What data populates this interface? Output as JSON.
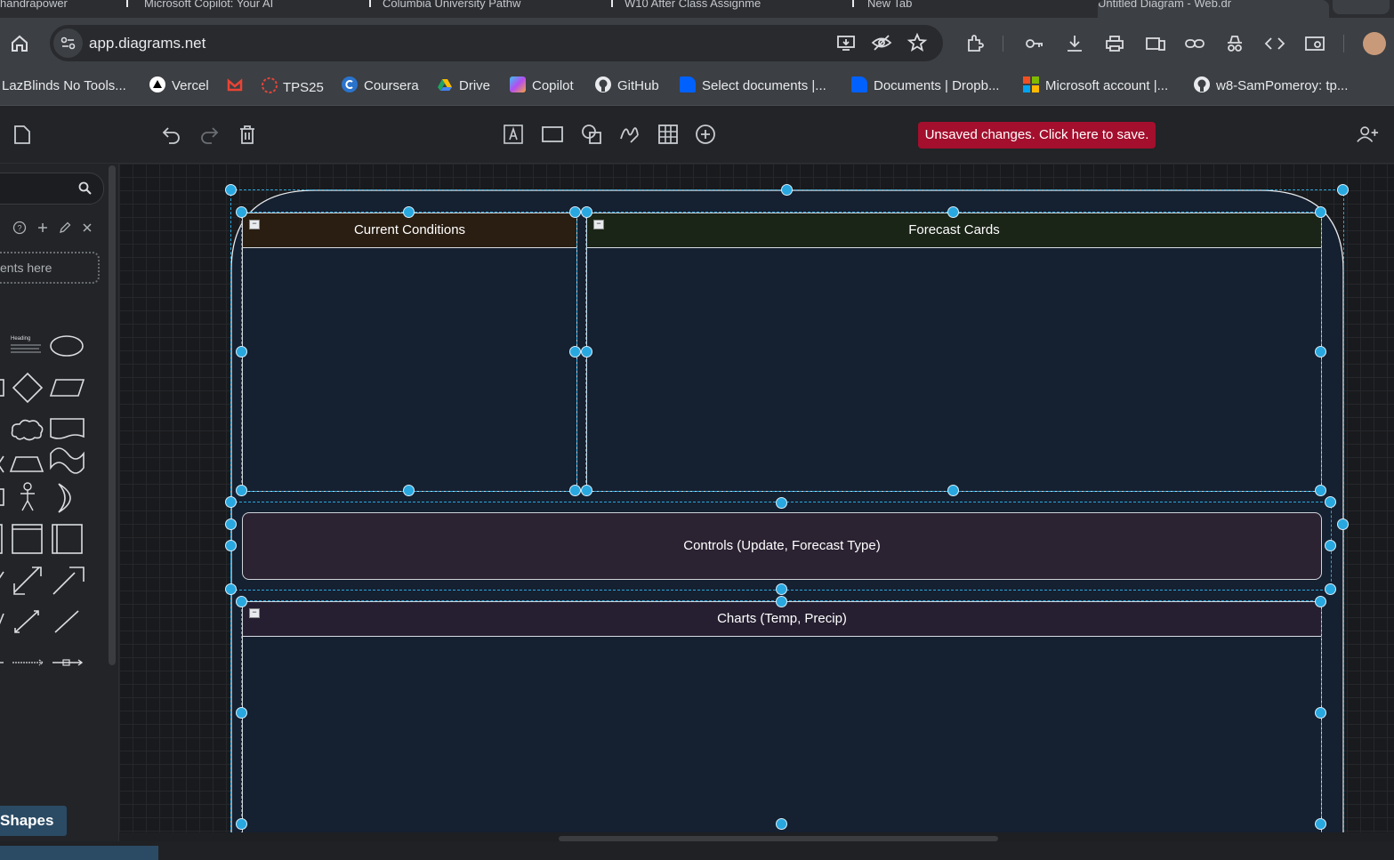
{
  "browser": {
    "tabs": [
      {
        "label": "handrapower"
      },
      {
        "label": "Microsoft Copilot: Your AI"
      },
      {
        "label": "Columbia University Pathw"
      },
      {
        "label": "W10 After Class Assignme"
      },
      {
        "label": "New Tab"
      },
      {
        "label": "Untitled Diagram - Web.dr"
      }
    ],
    "url": "app.diagrams.net",
    "bookmarks": [
      {
        "label": "LazBlinds No Tools...",
        "icon": "page-icon"
      },
      {
        "label": "Vercel",
        "icon": "vercel-icon"
      },
      {
        "label": "",
        "icon": "gmail-icon"
      },
      {
        "label": "TPS25",
        "icon": "tps-icon"
      },
      {
        "label": "Coursera",
        "icon": "coursera-icon"
      },
      {
        "label": "Drive",
        "icon": "drive-icon"
      },
      {
        "label": "Copilot",
        "icon": "copilot-icon"
      },
      {
        "label": "GitHub",
        "icon": "github-icon"
      },
      {
        "label": "Select documents |...",
        "icon": "dropbox-icon"
      },
      {
        "label": "Documents | Dropb...",
        "icon": "dropbox-icon"
      },
      {
        "label": "Microsoft account |...",
        "icon": "microsoft-icon"
      },
      {
        "label": "w8-SamPomeroy: tp...",
        "icon": "github-icon"
      }
    ]
  },
  "app": {
    "save_notice": "Unsaved changes. Click here to save.",
    "sidebar": {
      "scratchpad_hint": "ents here",
      "shapes_button": "Shapes",
      "heading_sample": "Heading"
    }
  },
  "diagram": {
    "current_conditions": "Current Conditions",
    "forecast_cards": "Forecast Cards",
    "controls": "Controls (Update, Forecast Type)",
    "charts": "Charts (Temp, Precip)"
  },
  "colors": {
    "accent": "#29a8e0",
    "save_button": "#a30f2d",
    "container_fill": "#152030",
    "current_header": "#2a1e12",
    "forecast_header": "#1a2417",
    "controls_fill": "#2b2232",
    "charts_header": "#261f31"
  }
}
